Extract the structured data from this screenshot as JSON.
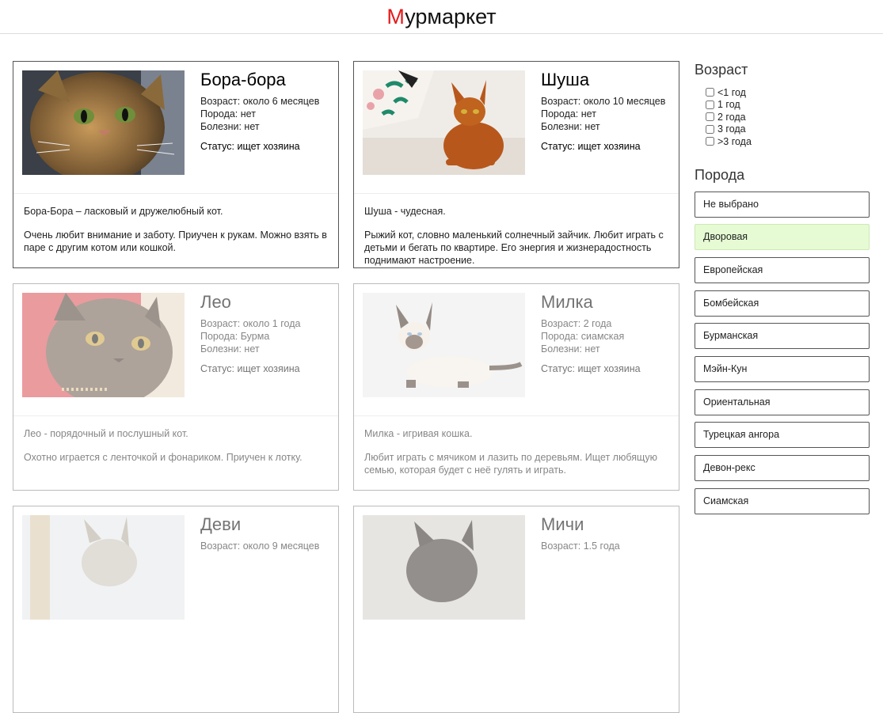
{
  "header": {
    "logo_first": "М",
    "logo_rest": "урмаркет"
  },
  "cats": [
    {
      "name": "Бора-бора",
      "age": "Возраст: около 6 месяцев",
      "breed": "Порода: нет",
      "illness": "Болезни: нет",
      "status": "Статус: ищет хозяина",
      "desc1": "Бора-Бора – ласковый и дружелюбный кот.",
      "desc2": "Очень любит внимание и заботу. Приучен к рукам. Можно взять в паре с другим котом или кошкой."
    },
    {
      "name": "Шуша",
      "age": "Возраст: около 10 месяцев",
      "breed": "Порода: нет",
      "illness": "Болезни: нет",
      "status": "Статус: ищет хозяина",
      "desc1": "Шуша - чудесная.",
      "desc2": "Рыжий кот, словно маленький солнечный зайчик. Любит играть с детьми и бегать по квартире. Его энергия и жизнерадостность поднимают настроение."
    },
    {
      "name": "Лео",
      "age": "Возраст: около 1 года",
      "breed": "Порода: Бурма",
      "illness": "Болезни: нет",
      "status": "Статус: ищет хозяина",
      "desc1": "Лео - порядочный и послушный кот.",
      "desc2": "Охотно играется с ленточкой и фонариком. Приучен к лотку."
    },
    {
      "name": "Милка",
      "age": "Возраст: 2 года",
      "breed": "Порода: сиамская",
      "illness": "Болезни: нет",
      "status": "Статус: ищет хозяина",
      "desc1": "Милка - игривая кошка.",
      "desc2": "Любит играть с мячиком и лазить по деревьям. Ищет любящую семью, которая будет с неё гулять и играть."
    },
    {
      "name": "Деви",
      "age": "Возраст: около 9 месяцев"
    },
    {
      "name": "Мичи",
      "age": "Возраст: 1.5 года"
    }
  ],
  "sidebar": {
    "age_title": "Возраст",
    "ages": [
      "<1 год",
      "1 год",
      "2 года",
      "3 года",
      ">3 года"
    ],
    "breed_title": "Порода",
    "breeds": [
      "Не выбрано",
      "Дворовая",
      "Европейская",
      "Бомбейская",
      "Бурманская",
      "Мэйн-Кун",
      "Ориентальная",
      "Турецкая ангора",
      "Девон-рекс",
      "Сиамская"
    ],
    "active_breed": "Дворовая"
  },
  "colors": {
    "accent": "#e31b1b",
    "active_filter_bg": "#e6fbd4"
  }
}
